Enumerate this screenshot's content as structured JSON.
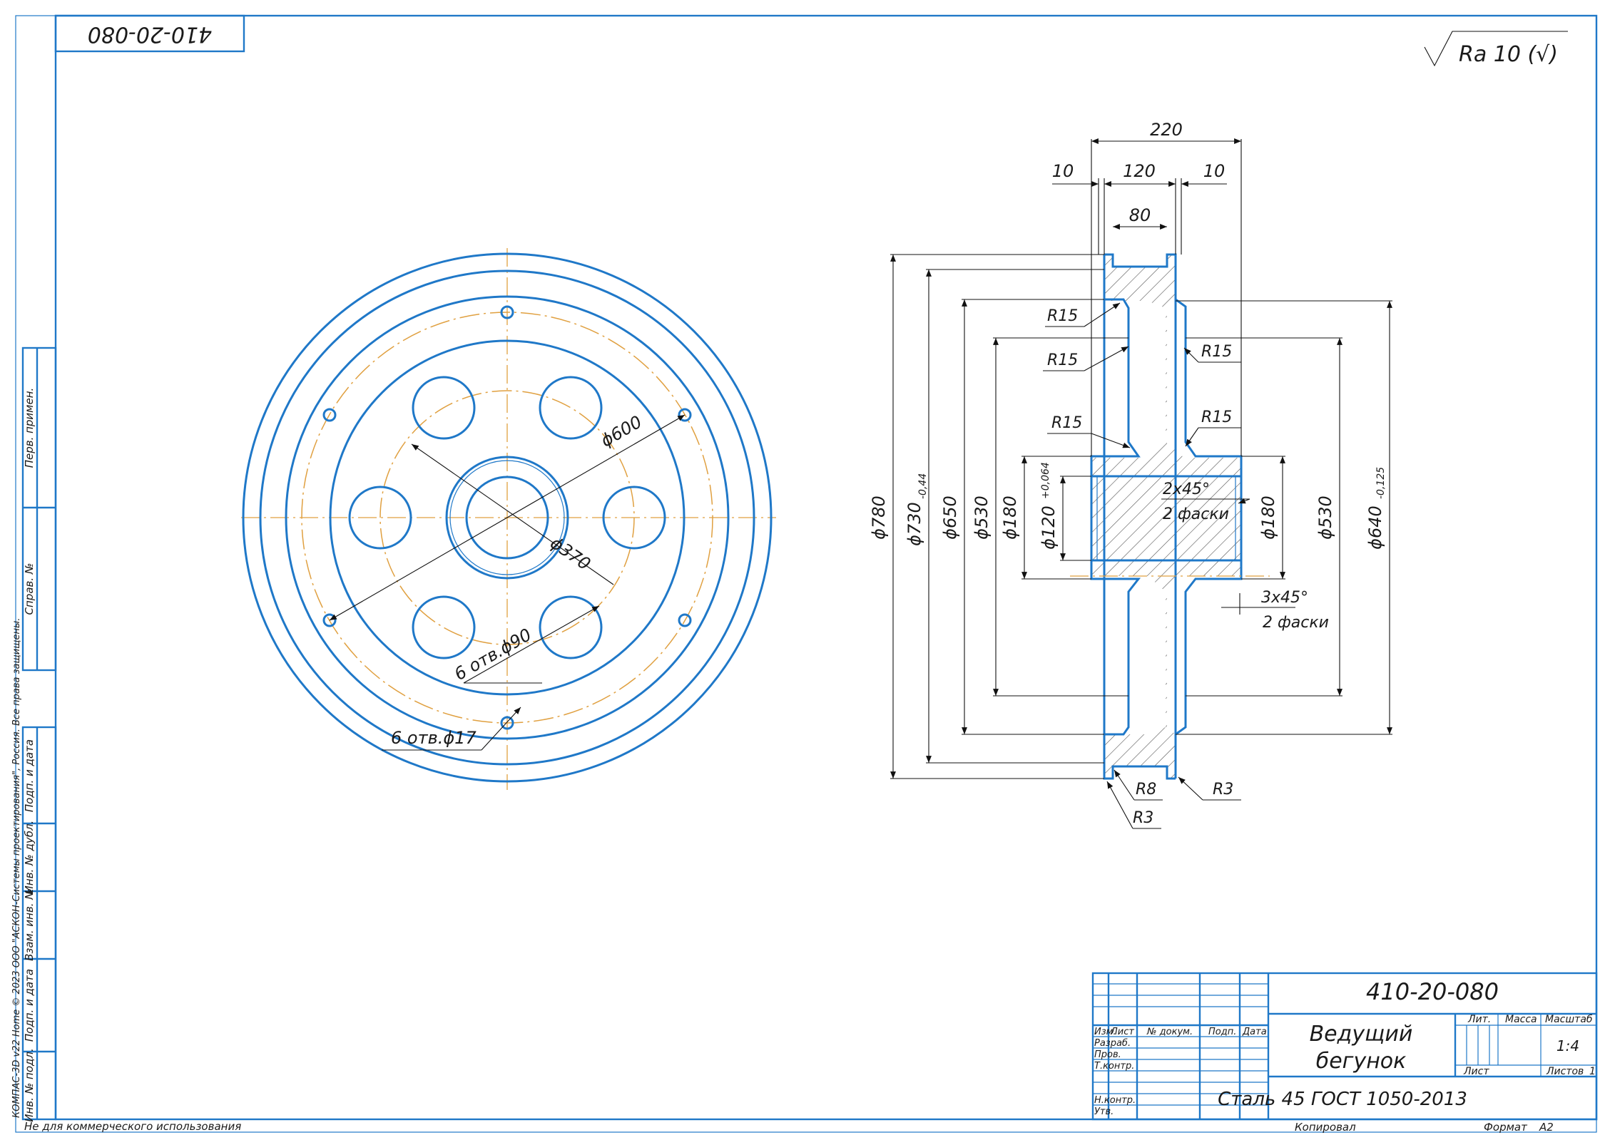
{
  "drawing": {
    "designation": "410-20-080",
    "designation_rotated": "410-20-080",
    "title_line1": "Ведущий",
    "title_line2": "бегунок",
    "material": "Сталь 45 ГОСТ 1050-2013",
    "scale": "1:4",
    "sheets_total": "1",
    "roughness": "Ra 10 (√)",
    "colors": {
      "line": "#1f78c8",
      "axis": "#e0a040",
      "dim": "#111111"
    }
  },
  "title_block": {
    "headers": [
      "Изм.",
      "Лист",
      "№ докум.",
      "Подп.",
      "Дата"
    ],
    "roles": [
      "Разраб.",
      "Пров.",
      "Т.контр.",
      "Н.контр.",
      "Утв."
    ],
    "lit_label": "Лит.",
    "mass_label": "Масса",
    "scale_label": "Масштаб",
    "sheet_label": "Лист",
    "sheets_label": "Листов",
    "copied_label": "Копировал",
    "format_label": "Формат",
    "format_value": "А2"
  },
  "side_stamps": [
    "Перв. примен.",
    "Справ. №",
    "Подп. и дата",
    "Инв. № дубл.",
    "Взам. инв. №",
    "Подп. и дата",
    "Инв. № подл."
  ],
  "footer": {
    "noncommercial": "Не для коммерческого использования",
    "copyright": "КОМПАС-3D v22 Home © 2023 ООО \"АСКОН-Системы проектирования\", Россия. Все права защищены."
  },
  "front_view": {
    "d600": "ϕ600",
    "d370": "ϕ370",
    "holes90": "6 отв.ϕ90",
    "holes17": "6 отв.ϕ17"
  },
  "section_view": {
    "w220": "220",
    "w10a": "10",
    "w120": "120",
    "w10b": "10",
    "w80": "80",
    "d780": "ϕ780",
    "d730": "ϕ730",
    "d730_tol": "-0,44",
    "d650": "ϕ650",
    "d530a": "ϕ530",
    "d180a": "ϕ180",
    "d120": "ϕ120",
    "d120_tol": "+0,064",
    "d180b": "ϕ180",
    "d530b": "ϕ530",
    "d640": "ϕ640",
    "d640_tol": "-0,125",
    "r15": "R15",
    "r8": "R8",
    "r3": "R3",
    "chamfer1": "2x45°",
    "chamfer1_note": "2 фаски",
    "chamfer2": "3x45°",
    "chamfer2_note": "2 фаски"
  }
}
